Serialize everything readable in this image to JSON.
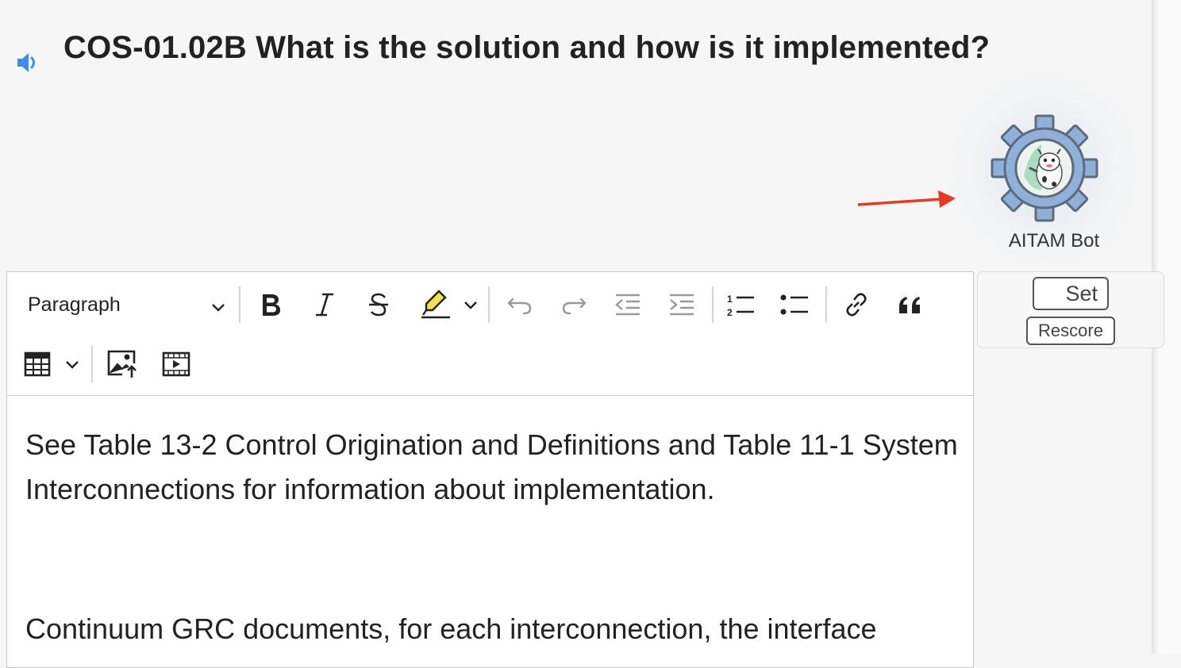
{
  "question": {
    "title": "COS-01.02B What is the solution and how is it implemented?",
    "speaker_icon": "speaker-icon"
  },
  "bot": {
    "label": "AITAM Bot",
    "icon": "gear-bot-icon",
    "colors": {
      "gear": "#8fb0d8",
      "gear_outline": "#5e6b7d",
      "arrow": "#e53a24"
    }
  },
  "editor": {
    "block_format": "Paragraph",
    "toolbar": {
      "row1": [
        "format-dropdown",
        "bold",
        "italic",
        "strikethrough",
        "highlight",
        "highlight-dropdown",
        "undo",
        "redo",
        "outdent",
        "indent",
        "numbered-list",
        "bulleted-list",
        "link",
        "block-quote"
      ],
      "row2": [
        "insert-table",
        "table-dropdown",
        "insert-image",
        "insert-media"
      ]
    },
    "content": [
      "See Table 13-2 Control Origination and Definitions and Table 11-1 System Interconnections for information about implementation.",
      "Continuum GRC documents, for each interconnection, the interface"
    ]
  },
  "scoring": {
    "set_label": "Set",
    "rescore_label": "Rescore"
  }
}
